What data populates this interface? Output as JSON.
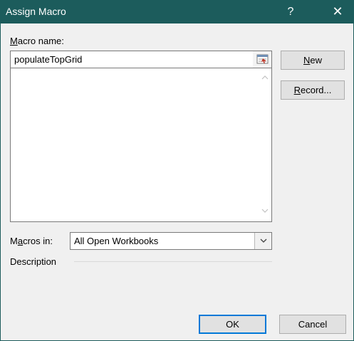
{
  "window": {
    "title": "Assign Macro",
    "help_label": "?",
    "close_label": "✕"
  },
  "macro_name": {
    "label_accel": "M",
    "label_rest": "acro name:",
    "value": "populateTopGrid"
  },
  "buttons": {
    "new_accel": "N",
    "new_rest": "ew",
    "record_accel": "R",
    "record_rest": "ecord...",
    "ok_label": "OK",
    "cancel_label": "Cancel"
  },
  "macros_in": {
    "label_pre": "M",
    "label_accel": "a",
    "label_rest": "cros in:",
    "selected": "All Open Workbooks"
  },
  "description": {
    "label": "Description"
  },
  "colors": {
    "titlebar": "#1c5c5c",
    "dialog_bg": "#f0f0f0",
    "button_bg": "#e1e1e1"
  },
  "icons": [
    "collapse-dialog-icon",
    "scroll-up-icon",
    "scroll-down-icon",
    "chevron-down-icon",
    "close-icon"
  ]
}
